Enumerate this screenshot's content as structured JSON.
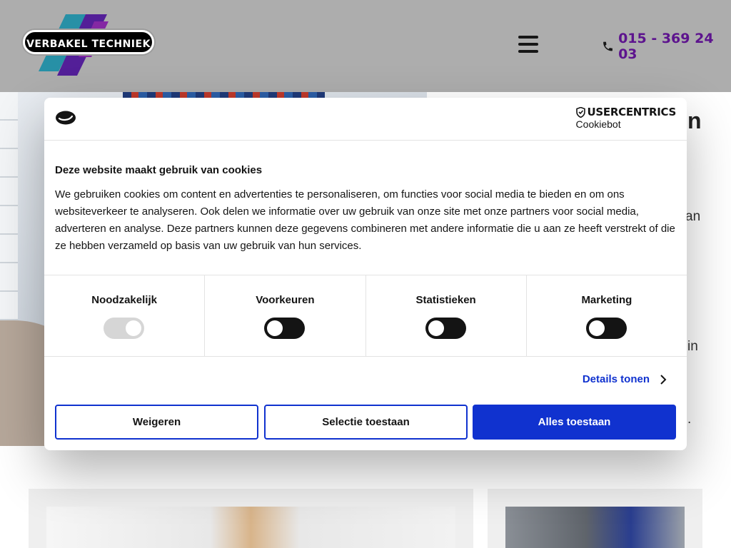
{
  "site": {
    "logo_text": "VERBAKEL TECHNIEK",
    "phone": "015 - 369 24 03",
    "intro_fragments": [
      "n",
      "an",
      "in",
      "."
    ]
  },
  "cookie_dialog": {
    "brand_name": "USERCENTRICS",
    "brand_sub": "Cookiebot",
    "title": "Deze website maakt gebruik van cookies",
    "text": "We gebruiken cookies om content en advertenties te personaliseren, om functies voor social media te bieden en om ons websiteverkeer te analyseren. Ook delen we informatie over uw gebruik van onze site met onze partners voor social media, adverteren en analyse. Deze partners kunnen deze gegevens combineren met andere informatie die u aan ze heeft verstrekt of die ze hebben verzameld op basis van uw gebruik van hun services.",
    "categories": [
      {
        "label": "Noodzakelijk",
        "checked": true,
        "disabled": true
      },
      {
        "label": "Voorkeuren",
        "checked": false,
        "disabled": false
      },
      {
        "label": "Statistieken",
        "checked": false,
        "disabled": false
      },
      {
        "label": "Marketing",
        "checked": false,
        "disabled": false
      }
    ],
    "details_label": "Details tonen",
    "buttons": {
      "deny": "Weigeren",
      "allow_selection": "Selectie toestaan",
      "allow_all": "Alles toestaan"
    }
  },
  "colors": {
    "accent_blue": "#1032cf",
    "phone_purple": "#8a1ed1",
    "text": "#141414"
  },
  "icons": [
    "phone-icon",
    "hamburger-menu-icon",
    "cookie-logo-icon",
    "usercentrics-shield-icon",
    "chevron-right-icon"
  ]
}
